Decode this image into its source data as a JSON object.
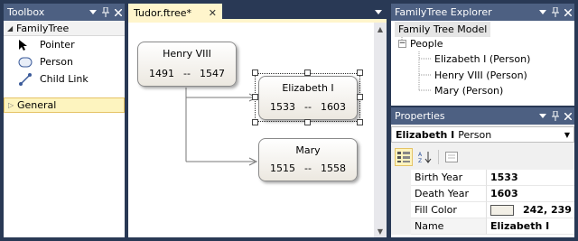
{
  "toolbox": {
    "title": "Toolbox",
    "group": "FamilyTree",
    "items": [
      {
        "label": "Pointer",
        "icon": "pointer-arrow-icon"
      },
      {
        "label": "Person",
        "icon": "person-shape-icon"
      },
      {
        "label": "Child Link",
        "icon": "connector-icon"
      }
    ],
    "general": "General"
  },
  "document": {
    "tab": "Tudor.ftree*",
    "shapes": [
      {
        "name": "Henry VIII",
        "birth": "1491",
        "sep": "--",
        "death": "1547"
      },
      {
        "name": "Elizabeth I",
        "birth": "1533",
        "sep": "--",
        "death": "1603"
      },
      {
        "name": "Mary",
        "birth": "1515",
        "sep": "--",
        "death": "1558"
      }
    ]
  },
  "explorer": {
    "title": "FamilyTree Explorer",
    "root": "Family Tree Model",
    "folder": "People",
    "children": [
      "Elizabeth I (Person)",
      "Henry VIII (Person)",
      "Mary (Person)"
    ]
  },
  "properties": {
    "title": "Properties",
    "selected_name": "Elizabeth I",
    "selected_type": "Person",
    "rows": [
      {
        "name": "Birth Year",
        "value": "1533"
      },
      {
        "name": "Death Year",
        "value": "1603"
      },
      {
        "name": "Fill Color",
        "value": "242, 239"
      },
      {
        "name": "Name",
        "value": "Elizabeth I"
      }
    ],
    "fill_swatch_color": "#f2efe6"
  },
  "colors": {
    "background": "#293955",
    "panel_header": "#4d6082",
    "tab_active": "#fff5cc",
    "selection": "#fdf4bf"
  }
}
